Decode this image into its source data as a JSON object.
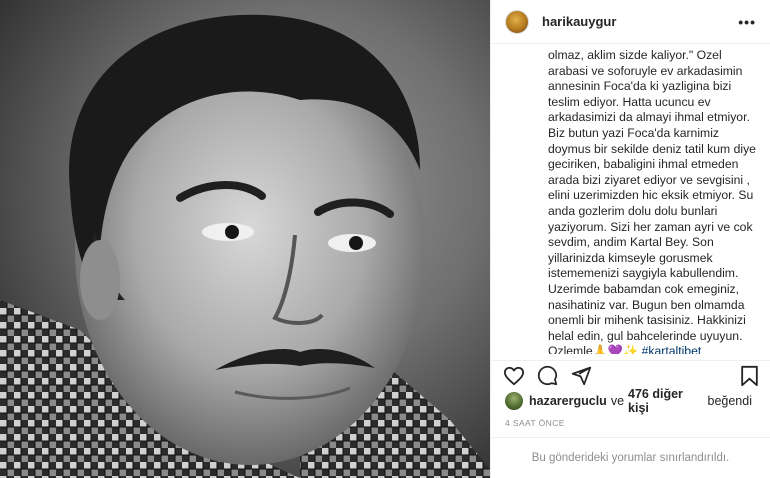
{
  "post": {
    "username": "harikauygur",
    "more_icon": "more-horizontal-icon",
    "caption_lines": [
      "olmaz, aklim sizde kaliyor.\" Ozel",
      "arabasi ve soforuyle ev arkadasimin",
      "annesinin Foca'da ki yazligina bizi",
      "teslim ediyor. Hatta ucuncu ev",
      "arkadasimizi da almayi ihmal etmiyor.",
      "Biz butun yazi Foca'da karnimiz",
      "doymus bir sekilde deniz tatil kum diye",
      "geciriken, babaligini ihmal etmeden",
      "arada bizi ziyaret ediyor ve sevgisini ,",
      " elini uzerimizden hic eksik etmiyor. Su",
      "anda gozlerim dolu dolu bunlari",
      "yaziyorum. Sizi her zaman ayri ve cok",
      "sevdim, andim Kartal Bey. Son",
      "yillarinizda kimseyle gorusmek",
      "istememenizi saygiyla kabullendim.",
      "Uzerimde babamdan cok emeginiz,",
      "nasihatiniz var. Bugun ben olmamda",
      "onemli bir mihenk tasisiniz. Hakkinizi",
      "helal edin, gul bahcelerinde uyuyun."
    ],
    "caption_last": "Ozlemle",
    "caption_emojis": "🙏💜✨",
    "hashtag": "#kartaltibet"
  },
  "actions": {
    "like_icon": "heart-icon",
    "comment_icon": "comment-icon",
    "share_icon": "share-icon",
    "save_icon": "bookmark-icon"
  },
  "likes": {
    "user": "hazarerguclu",
    "connector": "ve",
    "others": "476 diğer kişi",
    "suffix": "beğendi"
  },
  "timestamp": "4 saat önce",
  "comments_limited": "Bu gönderideki yorumlar sınırlandırıldı.",
  "colors": {
    "text": "#262626",
    "muted": "#8e8e8e",
    "hashtag": "#00376b",
    "border": "#efefef"
  }
}
